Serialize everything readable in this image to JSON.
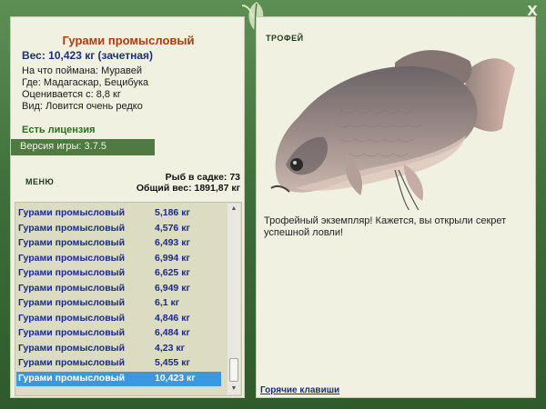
{
  "window": {
    "close_label": "X"
  },
  "fish": {
    "name": "Гурами промысловый",
    "weight": "Вес: 10,423 кг (зачетная)",
    "bait": "На что поймана: Муравей",
    "location": "Где: Мадагаскар, Бецибука",
    "value": "Оценивается с: 8,8 кг",
    "kind": "Вид: Ловится очень редко"
  },
  "license": "Есть лицензия",
  "version": "Версия игры: 3.7.5",
  "menu_title": "МЕНЮ",
  "cage": {
    "count": "Рыб в садке: 73",
    "total": "Общий вес: 1891,87 кг"
  },
  "catch_list": [
    {
      "name": "Гурами промысловый",
      "kg": "5,186 кг",
      "selected": false
    },
    {
      "name": "Гурами промысловый",
      "kg": "4,576 кг",
      "selected": false
    },
    {
      "name": "Гурами промысловый",
      "kg": "6,493 кг",
      "selected": false
    },
    {
      "name": "Гурами промысловый",
      "kg": "6,994 кг",
      "selected": false
    },
    {
      "name": "Гурами промысловый",
      "kg": "6,625 кг",
      "selected": false
    },
    {
      "name": "Гурами промысловый",
      "kg": "6,949 кг",
      "selected": false
    },
    {
      "name": "Гурами промысловый",
      "kg": "6,1 кг",
      "selected": false
    },
    {
      "name": "Гурами промысловый",
      "kg": "4,846 кг",
      "selected": false
    },
    {
      "name": "Гурами промысловый",
      "kg": "6,484 кг",
      "selected": false
    },
    {
      "name": "Гурами промысловый",
      "kg": "4,23 кг",
      "selected": false
    },
    {
      "name": "Гурами промысловый",
      "kg": "5,455 кг",
      "selected": false
    },
    {
      "name": "Гурами промысловый",
      "kg": "10,423 кг",
      "selected": true
    }
  ],
  "trophy": {
    "title": "ТРОФЕЙ",
    "text": "Трофейный экземпляр! Кажется, вы открыли секрет успешной ловли!"
  },
  "hotkeys": "Горячие клавиши",
  "colors": {
    "frame": "#3d6d38",
    "panel": "#f1f1e2",
    "title": "#b23a0a",
    "weight": "#1b2f7a",
    "selected_row": "#3a97e2",
    "version_bar": "#4f7a41"
  }
}
